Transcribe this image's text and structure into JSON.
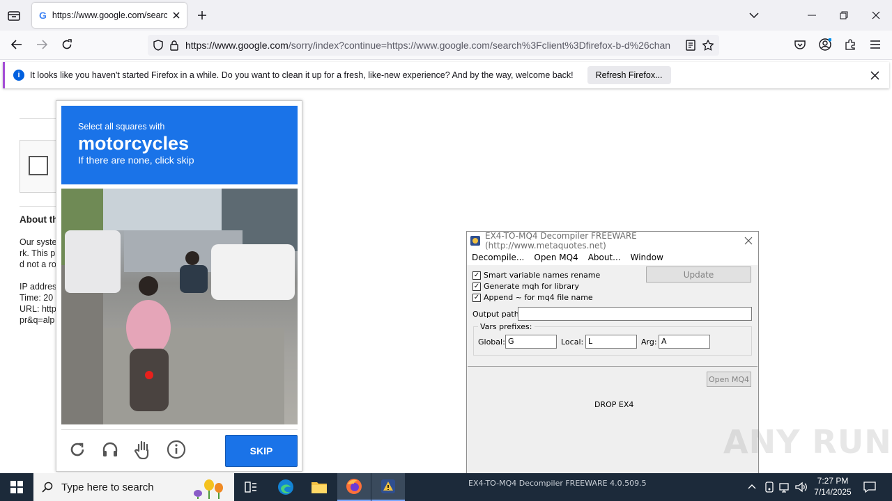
{
  "browser": {
    "tab_title": "https://www.google.com/search?client=firefox",
    "url_host": "https://www.google.com",
    "url_path": "/sorry/index?continue=https://www.google.com/search%3Fclient%3Dfirefox-b-d%26chan",
    "notification_message": "It looks like you haven't started Firefox in a while. Do you want to clean it up for a fresh, like-new experience? And by the way, welcome back!",
    "notification_button": "Refresh Firefox..."
  },
  "page": {
    "about_heading": "About th",
    "body_lines": [
      "Our syste",
      "rk. This p",
      "d not a ro"
    ],
    "ip_line": "IP addres",
    "time_line": "Time: 20",
    "url_line": "URL: http",
    "q_line": "pr&q=alp"
  },
  "captcha": {
    "instruction_top": "Select all squares with",
    "target": "motorcycles",
    "instruction_bottom": "If there are none, click skip",
    "skip_label": "SKIP"
  },
  "decompiler": {
    "title": "EX4-TO-MQ4 Decompiler FREEWARE (http://www.metaquotes.net)",
    "menu": [
      "Decompile...",
      "Open MQ4",
      "About...",
      "Window"
    ],
    "options": [
      {
        "label": "Smart variable names rename",
        "checked": true
      },
      {
        "label": "Generate mqh for library",
        "checked": true
      },
      {
        "label": "Append ~ for mq4 file name",
        "checked": true
      }
    ],
    "update_label": "Update",
    "output_path_label": "Output path:",
    "output_path_value": "",
    "vars_prefixes_label": "Vars prefixes:",
    "global_label": "Global:",
    "global_value": "G",
    "local_label": "Local:",
    "local_value": "L",
    "arg_label": "Arg:",
    "arg_value": "A",
    "open_mq4_label": "Open MQ4",
    "drop_label": "DROP EX4",
    "statusbar": "EX4-TO-MQ4 Decompiler FREEWARE  4.0.509.5"
  },
  "taskbar": {
    "search_placeholder": "Type here to search",
    "time": "7:27 PM",
    "date": "7/14/2025"
  },
  "watermark": "ANY RUN"
}
